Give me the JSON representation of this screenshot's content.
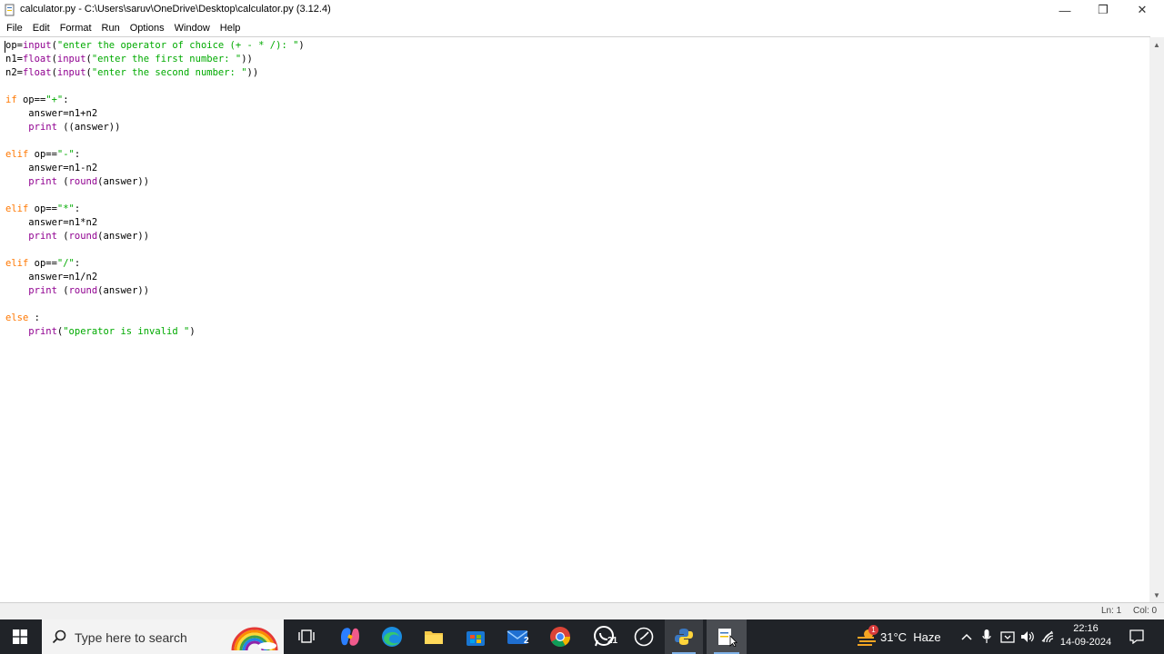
{
  "window": {
    "title": "calculator.py - C:\\Users\\saruv\\OneDrive\\Desktop\\calculator.py (3.12.4)",
    "minimize_glyph": "—",
    "maximize_glyph": "❐",
    "close_glyph": "✕"
  },
  "menu": {
    "items": [
      "File",
      "Edit",
      "Format",
      "Run",
      "Options",
      "Window",
      "Help"
    ]
  },
  "editor": {
    "lines": [
      "op=input(\"enter the operator of choice (+ - * /): \")",
      "n1=float(input(\"enter the first number: \"))",
      "n2=float(input(\"enter the second number: \"))",
      "",
      "if op==\"+\":",
      "    answer=n1+n2",
      "    print ((answer))",
      "",
      "elif op==\"-\":",
      "    answer=n1-n2",
      "    print (round(answer))",
      "",
      "elif op==\"*\":",
      "    answer=n1*n2",
      "    print (round(answer))",
      "",
      "elif op==\"/\":",
      "    answer=n1/n2",
      "    print (round(answer))",
      "",
      "else :",
      "    print(\"operator is invalid \")"
    ]
  },
  "status": {
    "line": "Ln: 1",
    "col": "Col: 0"
  },
  "taskbar": {
    "search_placeholder": "Type here to search",
    "mail_badge": "2",
    "whatsapp_badge": "21",
    "weather": "31°C  Haze",
    "weather_badge": "1",
    "time": "22:16",
    "date": "14-09-2024"
  },
  "colors": {
    "keyword": "#ff7700",
    "builtin": "#900090",
    "string": "#00aa00",
    "taskbar": "#202328"
  }
}
